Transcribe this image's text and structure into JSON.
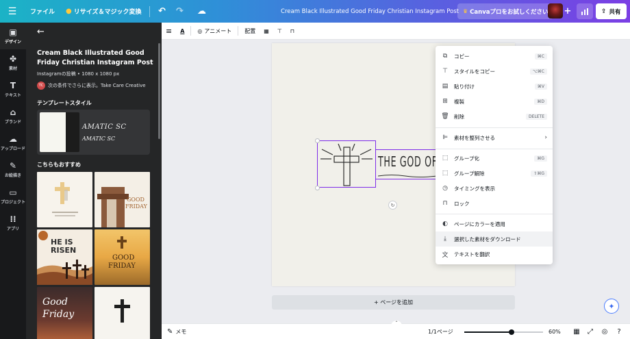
{
  "topbar": {
    "menu_icon": "hamburger-icon",
    "file_label": "ファイル",
    "resize_label": "リサイズ＆マジック変換",
    "title": "Cream Black Illustrated Good Friday Christian Instagram Post",
    "pro_label": "Canvaプロをお試しください",
    "share_label": "共有"
  },
  "rail": [
    {
      "label": "デザイン",
      "icon": "layout-icon"
    },
    {
      "label": "素材",
      "icon": "elements-icon"
    },
    {
      "label": "テキスト",
      "icon": "text-icon"
    },
    {
      "label": "ブランド",
      "icon": "brand-icon"
    },
    {
      "label": "アップロード",
      "icon": "upload-icon"
    },
    {
      "label": "お絵描き",
      "icon": "draw-icon"
    },
    {
      "label": "プロジェクト",
      "icon": "folder-icon"
    },
    {
      "label": "アプリ",
      "icon": "apps-icon"
    }
  ],
  "panel": {
    "title": "Cream Black Illustrated Good Friday Christian Instagram Post",
    "subtitle": "Instagramの投稿 • 1080 x 1080 px",
    "author_initials": "TC",
    "author_text": "次の条件でさらに表示。Take Care Creative",
    "template_style_heading": "テンプレートスタイル",
    "style_font_1": "AMATIC SC",
    "style_font_2": "AMATIC SC",
    "recommend_heading": "こちらもおすすめ",
    "thumbs": [
      {
        "text1": "",
        "text2": ""
      },
      {
        "text1": "GOOD",
        "text2": "FRIDAY"
      },
      {
        "text1": "HE IS",
        "text2": "RISEN"
      },
      {
        "text1": "GOOD",
        "text2": "FRIDAY"
      },
      {
        "text1": "Good",
        "text2": "Friday"
      },
      {
        "text1": "",
        "text2": ""
      }
    ]
  },
  "editor_toolbar": {
    "animate_label": "アニメート",
    "position_label": "配置"
  },
  "canvas": {
    "headline": "THE GOD OF",
    "add_page_label": "+ ページを追加"
  },
  "context_menu": [
    {
      "label": "コピー",
      "shortcut": "⌘C",
      "icon": "copy-icon"
    },
    {
      "label": "スタイルをコピー",
      "shortcut": "⌥⌘C",
      "icon": "paint-roller-icon"
    },
    {
      "label": "貼り付け",
      "shortcut": "⌘V",
      "icon": "clipboard-icon"
    },
    {
      "label": "複製",
      "shortcut": "⌘D",
      "icon": "duplicate-icon"
    },
    {
      "label": "削除",
      "shortcut": "DELETE",
      "icon": "trash-icon"
    },
    {
      "label": "素材を整列させる",
      "shortcut": "",
      "icon": "align-icon"
    },
    {
      "label": "グループ化",
      "shortcut": "⌘G",
      "icon": "group-icon"
    },
    {
      "label": "グループ解除",
      "shortcut": "⇧⌘G",
      "icon": "ungroup-icon"
    },
    {
      "label": "タイミングを表示",
      "shortcut": "",
      "icon": "clock-icon"
    },
    {
      "label": "ロック",
      "shortcut": "",
      "icon": "lock-icon"
    },
    {
      "label": "ページにカラーを適用",
      "shortcut": "",
      "icon": "palette-icon"
    },
    {
      "label": "選択した素材をダウンロード",
      "shortcut": "",
      "icon": "download-icon"
    },
    {
      "label": "テキストを翻訳",
      "shortcut": "",
      "icon": "translate-icon"
    }
  ],
  "bottombar": {
    "notes_label": "メモ",
    "page_indicator": "1/1ページ",
    "zoom_fraction": 0.6,
    "zoom_label": "60%"
  },
  "colors": {
    "selection": "#7d2ae8",
    "panel_bg": "#252627",
    "rail_bg": "#18191b"
  }
}
